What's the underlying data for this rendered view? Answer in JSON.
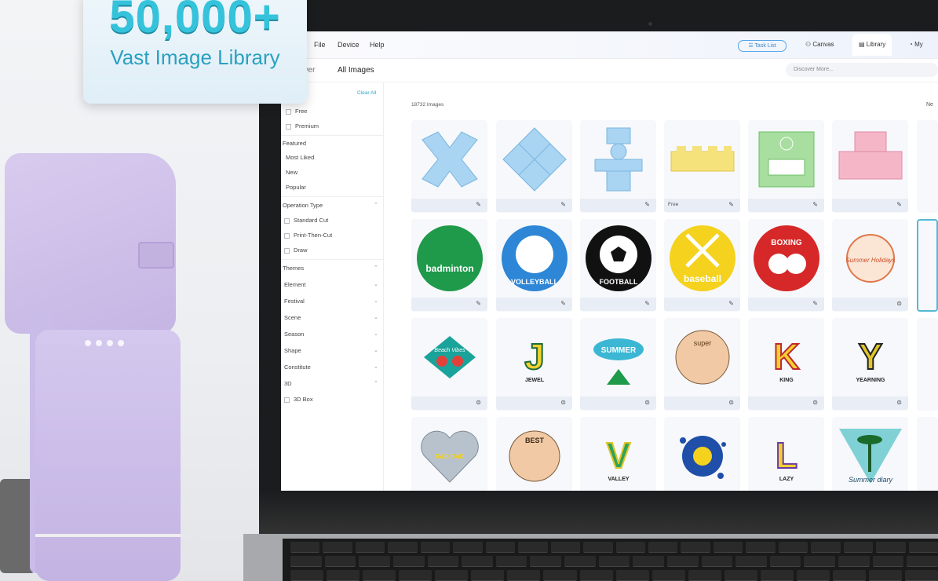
{
  "promo": {
    "headline": "50,000+",
    "subtitle": "Vast Image Library"
  },
  "menubar": {
    "menus": [
      "File",
      "Device",
      "Help"
    ],
    "task_list": "Task List",
    "tabs": [
      "Canvas",
      "Library",
      "My"
    ]
  },
  "subbar": {
    "discover_tab": "over",
    "all_images_tab": "All Images",
    "search_placeholder": "Discover More..."
  },
  "sidebar": {
    "clear_all": "Clear All",
    "filters_top": [
      "Free",
      "Premium"
    ],
    "featured_header": "Featured",
    "featured": [
      "Most Liked",
      "New",
      "Popular"
    ],
    "operation_header": "Operation Type",
    "operations": [
      "Standard Cut",
      "Print-Then-Cut",
      "Draw"
    ],
    "themes_header": "Themes",
    "themes": [
      "Element",
      "Festival",
      "Scene",
      "Season",
      "Shape",
      "Constitute"
    ],
    "three_d_header": "3D",
    "three_d": [
      "3D Box"
    ]
  },
  "grid": {
    "count": "18732 Images",
    "sort": "Ne",
    "rows": [
      [
        {
          "label": "",
          "icon": "edit"
        },
        {
          "label": "",
          "icon": "edit"
        },
        {
          "label": "",
          "icon": "edit"
        },
        {
          "label": "Free",
          "icon": "edit"
        },
        {
          "label": "",
          "icon": "edit"
        },
        {
          "label": "",
          "icon": "edit"
        }
      ],
      [
        {
          "label": "badminton",
          "icon": "edit"
        },
        {
          "label": "VOLLEYBALL",
          "icon": "edit"
        },
        {
          "label": "FOOTBALL",
          "icon": "edit"
        },
        {
          "label": "baseball",
          "icon": "edit"
        },
        {
          "label": "BOXING",
          "icon": "edit"
        },
        {
          "label": "Summer Holidays",
          "icon": "print"
        }
      ],
      [
        {
          "label": "Beach Vibes",
          "icon": "print"
        },
        {
          "label": "JEWEL",
          "icon": "print"
        },
        {
          "label": "SUMMER",
          "icon": "print"
        },
        {
          "label": "super",
          "icon": "print"
        },
        {
          "label": "KING",
          "icon": "print"
        },
        {
          "label": "YEARNING",
          "icon": "print"
        }
      ],
      [
        {
          "label": "R&D DAD"
        },
        {
          "label": "BEST"
        },
        {
          "label": "VALLEY"
        },
        {
          "label": "",
          "icon": ""
        },
        {
          "label": "LAZY"
        },
        {
          "label": "Summer diary"
        }
      ]
    ]
  }
}
